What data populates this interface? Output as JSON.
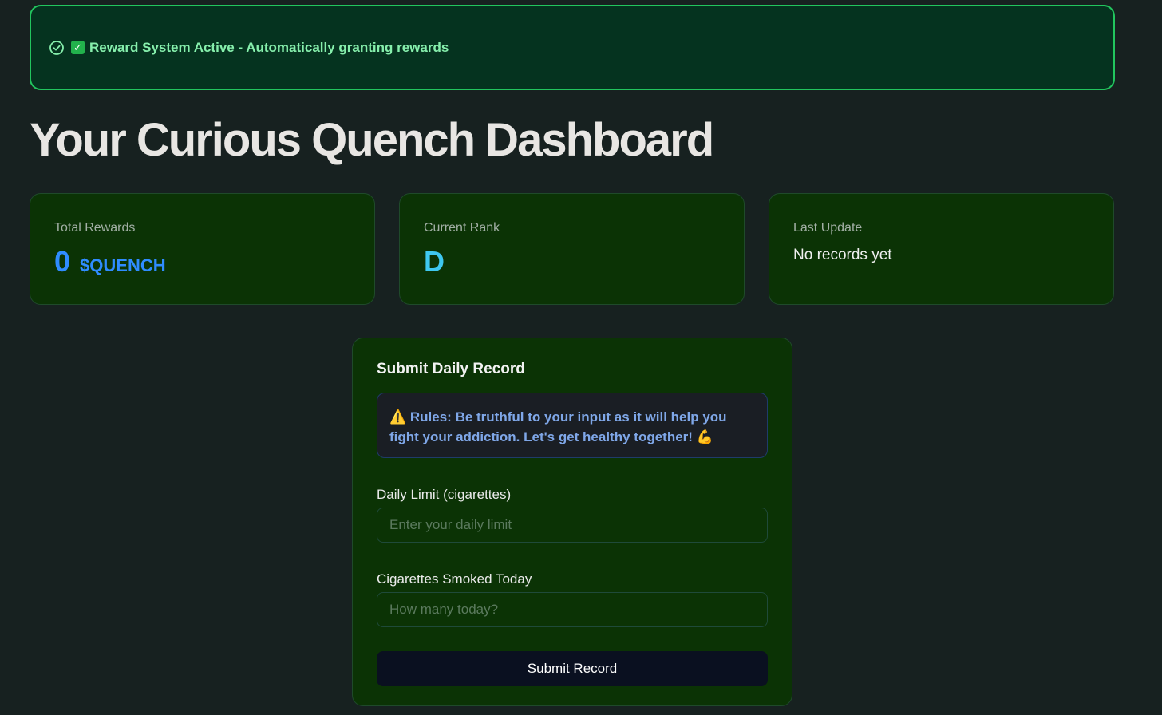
{
  "banner": {
    "status_icon": "check-circle-icon",
    "checkmark_emoji": "✓",
    "text": "Reward System Active - Automatically granting rewards",
    "accent_color": "#22c55e"
  },
  "page": {
    "title": "Your Curious Quench Dashboard"
  },
  "stats": {
    "total_rewards": {
      "label": "Total Rewards",
      "value": "0",
      "unit": "$QUENCH"
    },
    "current_rank": {
      "label": "Current Rank",
      "value": "D"
    },
    "last_update": {
      "label": "Last Update",
      "value": "No records yet"
    }
  },
  "form": {
    "title": "Submit Daily Record",
    "rules_text": "⚠️ Rules: Be truthful to your input as it will help you fight your addiction. Let's get healthy together! 💪",
    "daily_limit": {
      "label": "Daily Limit (cigarettes)",
      "placeholder": "Enter your daily limit",
      "value": ""
    },
    "smoked_today": {
      "label": "Cigarettes Smoked Today",
      "placeholder": "How many today?",
      "value": ""
    },
    "submit_label": "Submit Record"
  }
}
